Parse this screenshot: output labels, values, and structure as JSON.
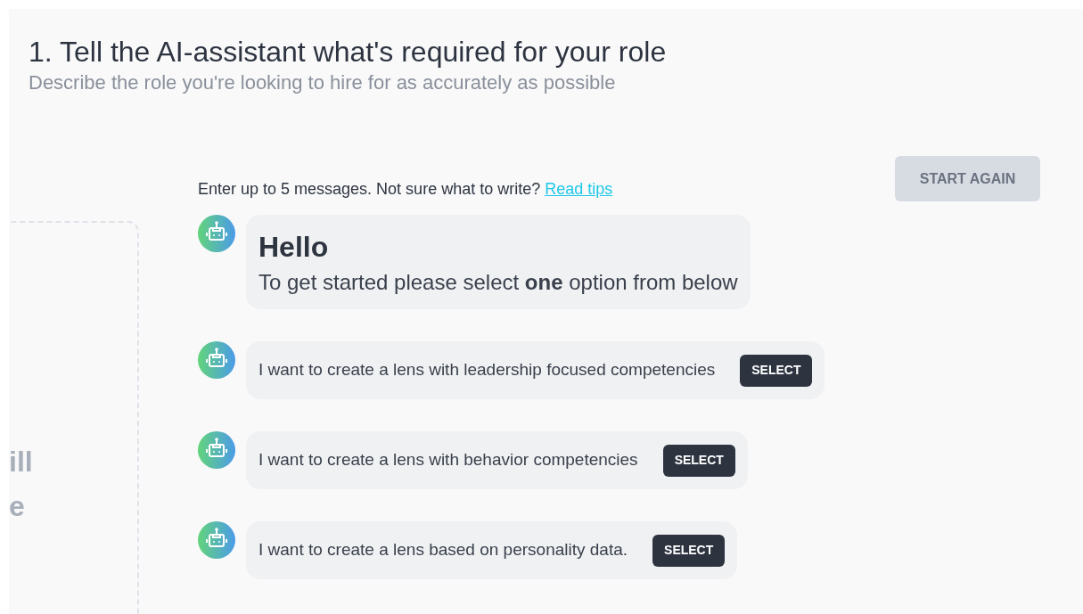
{
  "header": {
    "title": "1. Tell the AI-assistant what's required for your role",
    "subtitle": "Describe the role you're looking to hire for as accurately as possible"
  },
  "left_panel": {
    "text_fragments": [
      "ill",
      "e"
    ]
  },
  "instruction": {
    "text": "Enter up to 5 messages. Not sure what to write?",
    "link": "Read tips"
  },
  "start_again": {
    "label": "START AGAIN",
    "disabled": true
  },
  "greeting": {
    "heading": "Hello",
    "text": "To get started please select **one** option from below"
  },
  "options": [
    {
      "text": "I want to create a lens with leadership focused competencies",
      "button": "SELECT"
    },
    {
      "text": "I want to create a lens with behavior competencies",
      "button": "SELECT"
    },
    {
      "text": "I want to create a lens based on personality data.",
      "button": "SELECT"
    }
  ]
}
